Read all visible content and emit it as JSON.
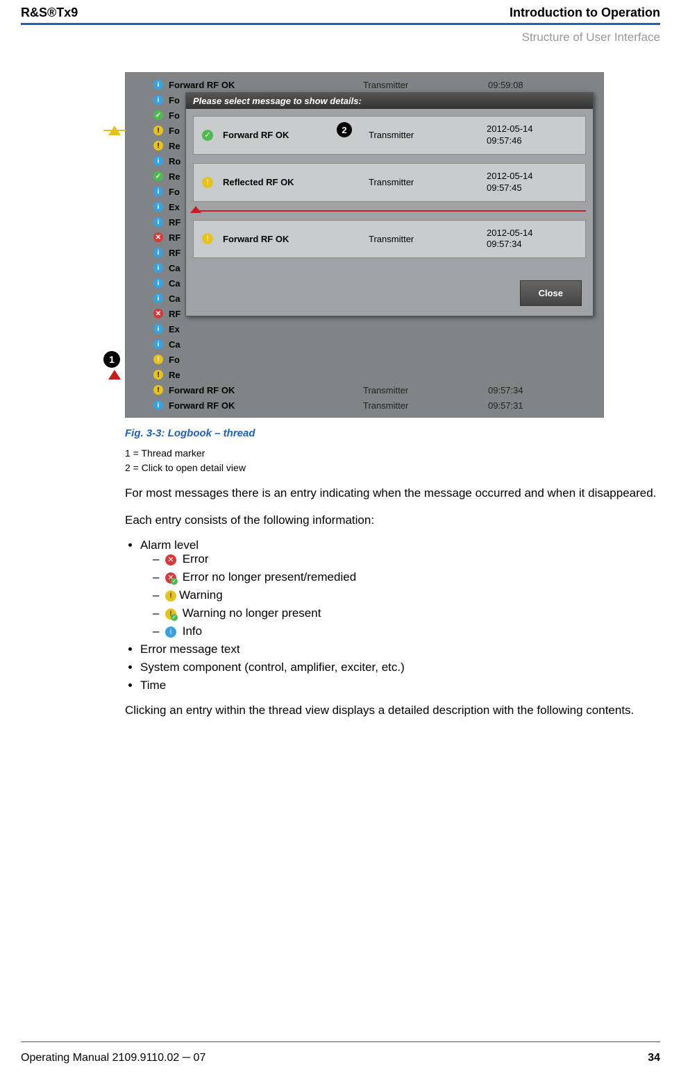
{
  "header": {
    "left": "R&S®Tx9",
    "right_line1": "Introduction to Operation",
    "right_line2": "Structure of User Interface"
  },
  "screenshot": {
    "bg_rows": [
      {
        "icon": "info",
        "msg": "Forward RF OK",
        "src": "Transmitter",
        "time": "09:59:08",
        "marker": ""
      },
      {
        "icon": "info",
        "msg": "Fo",
        "src": "",
        "time": "",
        "marker": ""
      },
      {
        "icon": "ok",
        "msg": "Fo",
        "src": "",
        "time": "",
        "marker": ""
      },
      {
        "icon": "warn",
        "msg": "Fo",
        "src": "",
        "time": "",
        "marker": "tri-y"
      },
      {
        "icon": "warn",
        "msg": "Re",
        "src": "",
        "time": "",
        "marker": ""
      },
      {
        "icon": "info",
        "msg": "Ro",
        "src": "",
        "time": "",
        "marker": ""
      },
      {
        "icon": "ok",
        "msg": "Re",
        "src": "",
        "time": "",
        "marker": ""
      },
      {
        "icon": "info",
        "msg": "Fo",
        "src": "",
        "time": "",
        "marker": ""
      },
      {
        "icon": "info",
        "msg": "Ex",
        "src": "",
        "time": "",
        "marker": ""
      },
      {
        "icon": "info",
        "msg": "RF",
        "src": "",
        "time": "",
        "marker": ""
      },
      {
        "icon": "errok",
        "msg": "RF",
        "src": "",
        "time": "",
        "marker": ""
      },
      {
        "icon": "info",
        "msg": "RF",
        "src": "",
        "time": "",
        "marker": ""
      },
      {
        "icon": "info",
        "msg": "Ca",
        "src": "",
        "time": "",
        "marker": ""
      },
      {
        "icon": "info",
        "msg": "Ca",
        "src": "",
        "time": "",
        "marker": ""
      },
      {
        "icon": "info",
        "msg": "Ca",
        "src": "",
        "time": "",
        "marker": ""
      },
      {
        "icon": "err",
        "msg": "RF",
        "src": "",
        "time": "",
        "marker": ""
      },
      {
        "icon": "info",
        "msg": "Ex",
        "src": "",
        "time": "",
        "marker": ""
      },
      {
        "icon": "info",
        "msg": "Ca",
        "src": "",
        "time": "",
        "marker": ""
      },
      {
        "icon": "warnok",
        "msg": "Fo",
        "src": "",
        "time": "",
        "marker": "circ-1"
      },
      {
        "icon": "warn",
        "msg": "Re",
        "src": "",
        "time": "",
        "marker": "tri-r"
      },
      {
        "icon": "warn",
        "msg": "Forward RF OK",
        "src": "Transmitter",
        "time": "09:57:34",
        "marker": ""
      },
      {
        "icon": "info",
        "msg": "Forward RF OK",
        "src": "Transmitter",
        "time": "09:57:31",
        "marker": ""
      }
    ],
    "popup": {
      "title": "Please select message to show details:",
      "items": [
        {
          "icon": "ok",
          "msg": "Forward RF OK",
          "src": "Transmitter",
          "ts": "2012-05-14\n09:57:46",
          "badge": "2"
        },
        {
          "icon": "warn",
          "msg": "Reflected RF OK",
          "src": "Transmitter",
          "ts": "2012-05-14\n09:57:45",
          "badge": ""
        },
        {
          "icon": "warn",
          "msg": "Forward RF OK",
          "src": "Transmitter",
          "ts": "2012-05-14\n09:57:34",
          "badge": "",
          "sep_before": true
        }
      ],
      "close": "Close"
    }
  },
  "figure_caption": "Fig. 3-3: Logbook – thread",
  "legend": {
    "l1": "1 = Thread marker",
    "l2": "2 = Click to open detail view"
  },
  "para1": "For most messages there is an entry indicating when the message occurred and when it disappeared.",
  "para2": "Each entry consists of the following information:",
  "list": {
    "alarm_level": "Alarm level",
    "err": "Error",
    "errok": "Error no longer present/remedied",
    "warn": "Warning",
    "warnok": "Warning no longer present",
    "info": "Info",
    "msg_text": "Error message text",
    "sys_comp": "System component (control, amplifier, exciter, etc.)",
    "time": "Time"
  },
  "para3": "Clicking an entry within the thread view displays a detailed description with the following contents.",
  "footer": {
    "left": "Operating Manual 2109.9110.02 ─ 07",
    "right": "34"
  }
}
